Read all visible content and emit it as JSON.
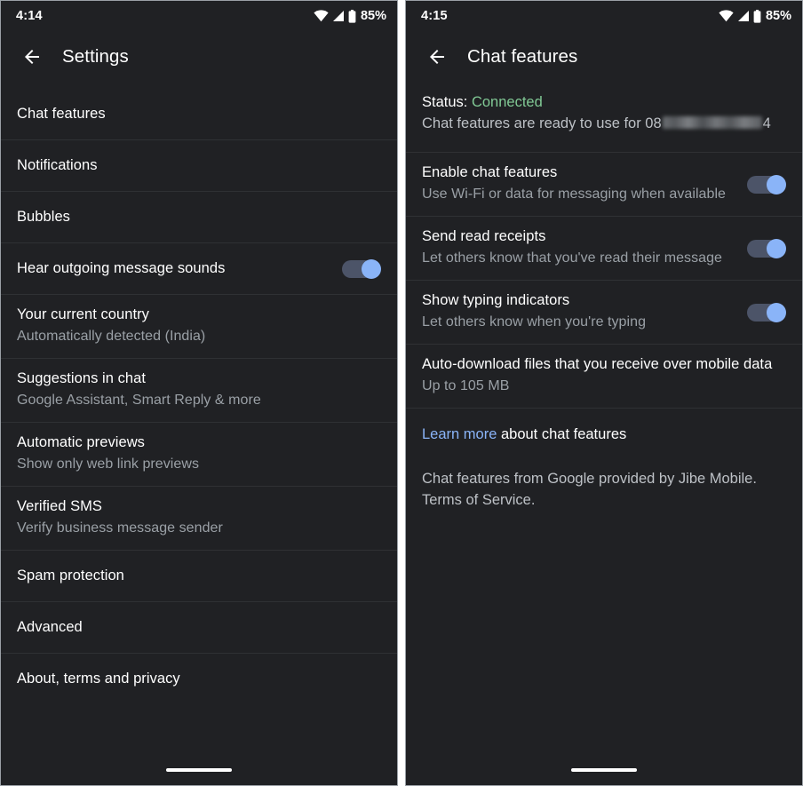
{
  "left": {
    "statusbar": {
      "time": "4:14",
      "battery": "85%",
      "icons": [
        "wifi-icon",
        "cellular-signal-icon",
        "battery-icon"
      ]
    },
    "appbar": {
      "back_icon": "back-arrow-icon",
      "title": "Settings"
    },
    "rows": [
      {
        "title": "Chat features",
        "sub": "",
        "toggle": null
      },
      {
        "title": "Notifications",
        "sub": "",
        "toggle": null
      },
      {
        "title": "Bubbles",
        "sub": "",
        "toggle": null
      },
      {
        "title": "Hear outgoing message sounds",
        "sub": "",
        "toggle": "on"
      },
      {
        "title": "Your current country",
        "sub": "Automatically detected (India)",
        "toggle": null
      },
      {
        "title": "Suggestions in chat",
        "sub": "Google Assistant, Smart Reply & more",
        "toggle": null
      },
      {
        "title": "Automatic previews",
        "sub": "Show only web link previews",
        "toggle": null
      },
      {
        "title": "Verified SMS",
        "sub": "Verify business message sender",
        "toggle": null
      },
      {
        "title": "Spam protection",
        "sub": "",
        "toggle": null
      },
      {
        "title": "Advanced",
        "sub": "",
        "toggle": null
      },
      {
        "title": "About, terms and privacy",
        "sub": "",
        "toggle": null
      }
    ]
  },
  "right": {
    "statusbar": {
      "time": "4:15",
      "battery": "85%",
      "icons": [
        "wifi-icon",
        "cellular-signal-icon",
        "battery-icon"
      ]
    },
    "appbar": {
      "back_icon": "back-arrow-icon",
      "title": "Chat features"
    },
    "status": {
      "label": "Status:",
      "value": "Connected",
      "detail_prefix": "Chat features are ready to use for 08",
      "detail_suffix": "4",
      "redacted": true
    },
    "rows": [
      {
        "title": "Enable chat features",
        "sub": "Use Wi-Fi or data for messaging when available",
        "toggle": "on"
      },
      {
        "title": "Send read receipts",
        "sub": "Let others know that you've read their message",
        "toggle": "on"
      },
      {
        "title": "Show typing indicators",
        "sub": "Let others know when you're typing",
        "toggle": "on"
      },
      {
        "title": "Auto-download files that you receive over mobile data",
        "sub": "Up to 105 MB",
        "toggle": null
      }
    ],
    "footer": {
      "link_text": "Learn more",
      "link_rest": " about chat features",
      "note": "Chat features from Google provided by Jibe Mobile. Terms of Service."
    }
  },
  "colors": {
    "background": "#202124",
    "divider": "#2f3134",
    "primary_text": "#ffffff",
    "secondary_text": "#9aa0a6",
    "accent_blue": "#8ab4f8",
    "toggle_track": "#4c5468",
    "status_green": "#81c995"
  }
}
